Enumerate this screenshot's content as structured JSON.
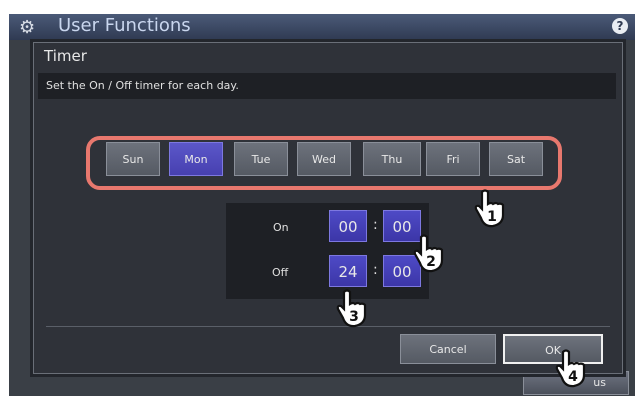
{
  "app": {
    "title": "User Functions",
    "help": "?"
  },
  "background": {
    "button_label": "us"
  },
  "dialog": {
    "title": "Timer",
    "message": "Set the On / Off timer for each day.",
    "days": [
      {
        "label": "Sun",
        "selected": false
      },
      {
        "label": "Mon",
        "selected": true
      },
      {
        "label": "Tue",
        "selected": false
      },
      {
        "label": "Wed",
        "selected": false
      },
      {
        "label": "Thu",
        "selected": false
      },
      {
        "label": "Fri",
        "selected": false
      },
      {
        "label": "Sat",
        "selected": false
      }
    ],
    "timer": {
      "on_label": "On",
      "on_hour": "00",
      "on_minute": "00",
      "off_label": "Off",
      "off_hour": "24",
      "off_minute": "00",
      "separator": ":"
    },
    "cancel_label": "Cancel",
    "ok_label": "OK"
  },
  "callouts": [
    "1",
    "2",
    "3",
    "4"
  ],
  "colors": {
    "selected": "#4a44bb",
    "highlight": "#e8786e",
    "header": "#3a4866"
  }
}
